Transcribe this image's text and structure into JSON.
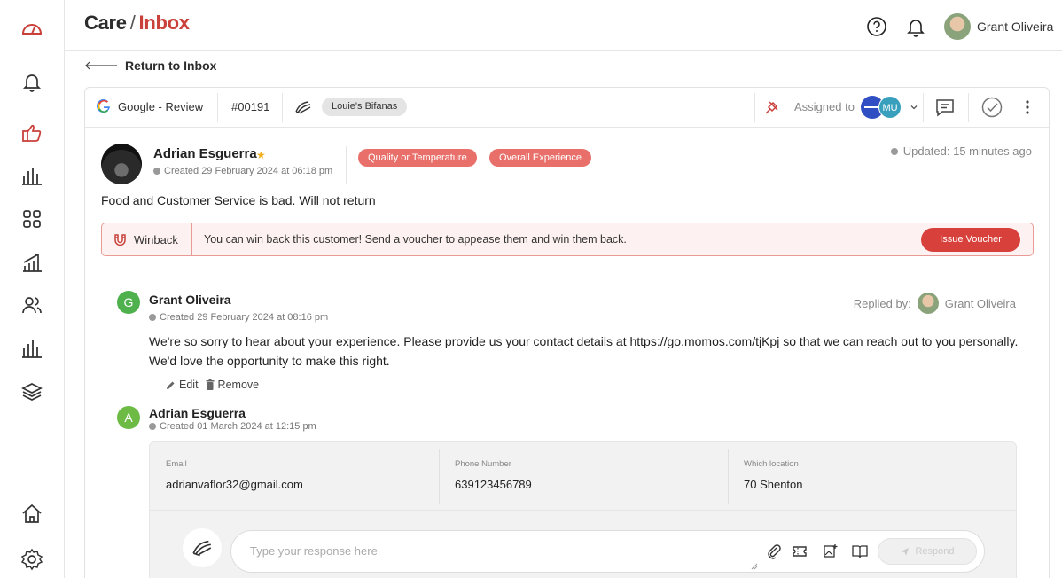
{
  "header": {
    "breadcrumb_parent": "Care",
    "breadcrumb_sep": "/",
    "breadcrumb_current": "Inbox",
    "user_name": "Grant Oliveira"
  },
  "back_label": "Return to Inbox",
  "toolbar": {
    "source": "Google - Review",
    "ticket_id": "#00191",
    "location_chip": "Louie's Bifanas",
    "assigned_label": "Assigned to",
    "assignee_initials": "MU"
  },
  "review": {
    "author": "Adrian Esguerra",
    "created": "Created 29 February 2024 at 06:18 pm",
    "tags": [
      "Quality or Temperature",
      "Overall Experience"
    ],
    "updated": "Updated: 15 minutes ago",
    "text": "Food and Customer Service is bad. Will not return"
  },
  "winback": {
    "label": "Winback",
    "message": "You can win back this customer! Send a voucher to appease them and win them back.",
    "button": "Issue Voucher"
  },
  "reply": {
    "initial": "G",
    "author": "Grant Oliveira",
    "created": "Created 29 February 2024 at 08:16 pm",
    "replied_label": "Replied by:",
    "replied_name": "Grant Oliveira",
    "text": "We're so sorry to hear about your experience. Please provide us your contact details at https://go.momos.com/tjKpj so that we can reach out to you personally. We'd love the opportunity to make this right.",
    "edit_label": "Edit",
    "remove_label": "Remove"
  },
  "customer_reply": {
    "initial": "A",
    "author": "Adrian Esguerra",
    "created": "Created 01 March 2024 at 12:15 pm",
    "fields": [
      {
        "label": "Email",
        "value": "adrianvaflor32@gmail.com"
      },
      {
        "label": "Phone Number",
        "value": "639123456789"
      },
      {
        "label": "Which location",
        "value": "70 Shenton"
      }
    ]
  },
  "composer": {
    "placeholder": "Type your response here",
    "send_label": "Respond"
  },
  "colors": {
    "accent": "#c9413a",
    "tag": "#e9706a",
    "voucher_button": "#d8413b",
    "reply_avatar": "#4fb04e"
  }
}
